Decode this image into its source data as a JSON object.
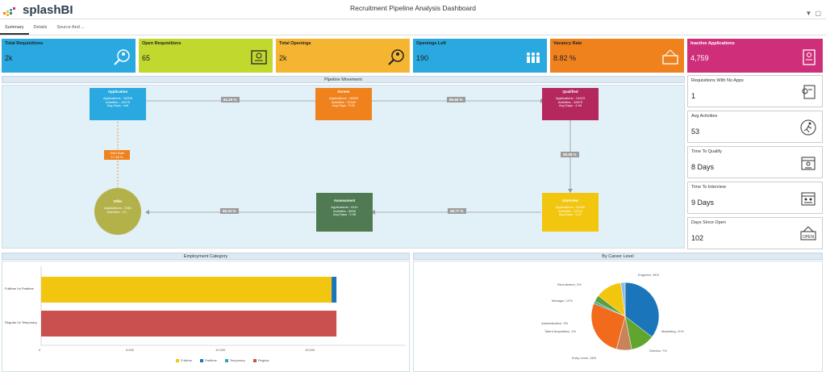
{
  "header": {
    "logo_text": "splashBI",
    "title": "Recruitment Pipeline Analysis Dashboard",
    "filter_icon": "filter-icon",
    "expand_icon": "expand-icon"
  },
  "tabs": [
    {
      "label": "Summary",
      "active": true
    },
    {
      "label": "Details",
      "active": false
    },
    {
      "label": "Source And ...",
      "active": false
    }
  ],
  "kpis": [
    {
      "label": "Total Requisitions",
      "value": "2k",
      "color": "#29a9e0",
      "icon": "magnifier-person-icon"
    },
    {
      "label": "Open Requisitions",
      "value": "65",
      "color": "#c1d82f",
      "icon": "id-card-icon"
    },
    {
      "label": "Total Openings",
      "value": "2k",
      "color": "#f5b531",
      "icon": "magnifier-person-icon"
    },
    {
      "label": "Openings Left",
      "value": "190",
      "color": "#29a9e0",
      "icon": "people-group-icon"
    },
    {
      "label": "Vacancy Rate",
      "value": "8.82 %",
      "color": "#f0821e",
      "icon": "vacancy-sign-icon"
    },
    {
      "label": "Inactive Applications",
      "value": "4,759",
      "color": "#cf2f7a",
      "icon": "document-person-icon"
    }
  ],
  "side_cards": [
    {
      "label": "Requisitions With No Apps",
      "value": "1",
      "icon": "person-document-icon"
    },
    {
      "label": "Avg Activities",
      "value": "53",
      "icon": "running-person-icon"
    },
    {
      "label": "Time To Qualify",
      "value": "8 Days",
      "icon": "calendar-person-icon"
    },
    {
      "label": "Time To Interview",
      "value": "9 Days",
      "icon": "calendar-interview-icon"
    },
    {
      "label": "Days Since Open",
      "value": "102",
      "icon": "open-sign-icon"
    }
  ],
  "pipeline": {
    "title": "Pipeline Movement",
    "nodes": [
      {
        "name": "Application",
        "lines": [
          "Applications : 16006",
          "Activities : 19175",
          "Avg Days : null"
        ],
        "color": "#29a9e0"
      },
      {
        "name": "Screen",
        "lines": [
          "Applications : 16830",
          "Activities : 12182",
          "Avg Days : 5.02"
        ],
        "color": "#f0821e"
      },
      {
        "name": "Qualified",
        "lines": [
          "Applications : 14423",
          "Activities : 16675",
          "Avg Days : 4.94"
        ],
        "color": "#b5285e"
      },
      {
        "name": "Interview",
        "lines": [
          "Applications : 14280",
          "Activities : 12110",
          "Avg Days : 4.07"
        ],
        "color": "#f2c60f"
      },
      {
        "name": "Assessment",
        "lines": [
          "Applications : 6111",
          "Activities : 8905",
          "Avg Days : 3.98"
        ],
        "color": "#4f7a52"
      },
      {
        "name": "Offer",
        "lines": [
          "Applications : 2360",
          "Activities : 12..."
        ],
        "color": "#b3b24a"
      }
    ],
    "conversions": [
      "84.29 %",
      "85.66 %",
      "99.08 %",
      "38.77 %",
      "86.33 %"
    ],
    "yield": {
      "label": "Yield Rate",
      "value": "17.48 %"
    }
  },
  "employment": {
    "title": "Employment Category",
    "categories": [
      "Fulltime Vs Parttime",
      "Regular Vs Temporary"
    ],
    "xticks": [
      "0",
      "5,000",
      "10,000",
      "15,000"
    ],
    "legend": [
      "Fulltime",
      "Parttime",
      "Temporary",
      "Regular"
    ]
  },
  "career": {
    "title": "By Career Level",
    "labels": [
      "Engineer, 34%",
      "Marketing, 11%",
      "Director, 7%",
      "Entry Level, 26%",
      "Talent Acquisition, 1%",
      "Administrative, 3%",
      "Manager, 12%",
      "Recruitment, 2%"
    ]
  },
  "chart_data": [
    {
      "type": "bar",
      "orientation": "horizontal",
      "title": "Employment Category",
      "categories": [
        "Fulltime Vs Parttime",
        "Regular Vs Temporary"
      ],
      "series": [
        {
          "name": "Fulltime",
          "values": [
            11950,
            0
          ]
        },
        {
          "name": "Parttime",
          "values": [
            200,
            0
          ]
        },
        {
          "name": "Temporary",
          "values": [
            0,
            0
          ]
        },
        {
          "name": "Regular",
          "values": [
            0,
            12150
          ]
        }
      ],
      "xlim": [
        0,
        15000
      ],
      "stacked": true,
      "legend": "bottom"
    },
    {
      "type": "pie",
      "title": "By Career Level",
      "categories": [
        "Engineer",
        "Marketing",
        "Director",
        "Entry Level",
        "Talent Acquisition",
        "Administrative",
        "Manager",
        "Recruitment"
      ],
      "values": [
        34,
        11,
        7,
        26,
        1,
        3,
        12,
        2
      ]
    }
  ]
}
